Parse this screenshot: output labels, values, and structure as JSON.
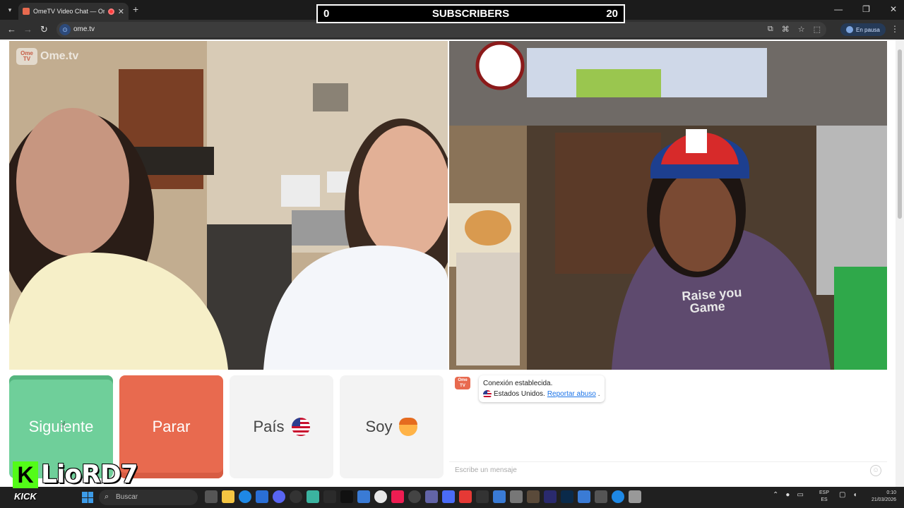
{
  "browser": {
    "tab_title": "OmeTV Video Chat — Ome",
    "tab_close": "✕",
    "new_tab": "+",
    "url": "ome.tv",
    "profile_status": "En pausa"
  },
  "stream_overlay": {
    "subscribers_current": "0",
    "subscribers_label": "SUBSCRIBERS",
    "subscribers_goal": "20",
    "kick_letter": "K",
    "kick_word": "KICK",
    "streamer_name": "LioRD7"
  },
  "ometv": {
    "logo_text": "Ome.tv",
    "badge_text": "Ome TV",
    "buttons": {
      "next": "Siguiente",
      "stop": "Parar",
      "country": "País",
      "soy": "Soy"
    },
    "chat": {
      "connection_message": "Conexión establecida.",
      "country": "Estados Unidos.",
      "report_link": "Reportar abuso",
      "report_suffix": ".",
      "input_placeholder": "Escribe un mensaje"
    },
    "shirt_text_line1": "Raise you",
    "shirt_text_line2": "Game"
  },
  "taskbar": {
    "search_placeholder": "Buscar",
    "language_line1": "ESP",
    "language_line2": "ES",
    "time": "0:10",
    "date": "21/03/2026"
  },
  "colors": {
    "next_button": "#6fcf9a",
    "stop_button": "#e86a4f",
    "kick_green": "#53fc18",
    "link": "#1a73e8"
  }
}
